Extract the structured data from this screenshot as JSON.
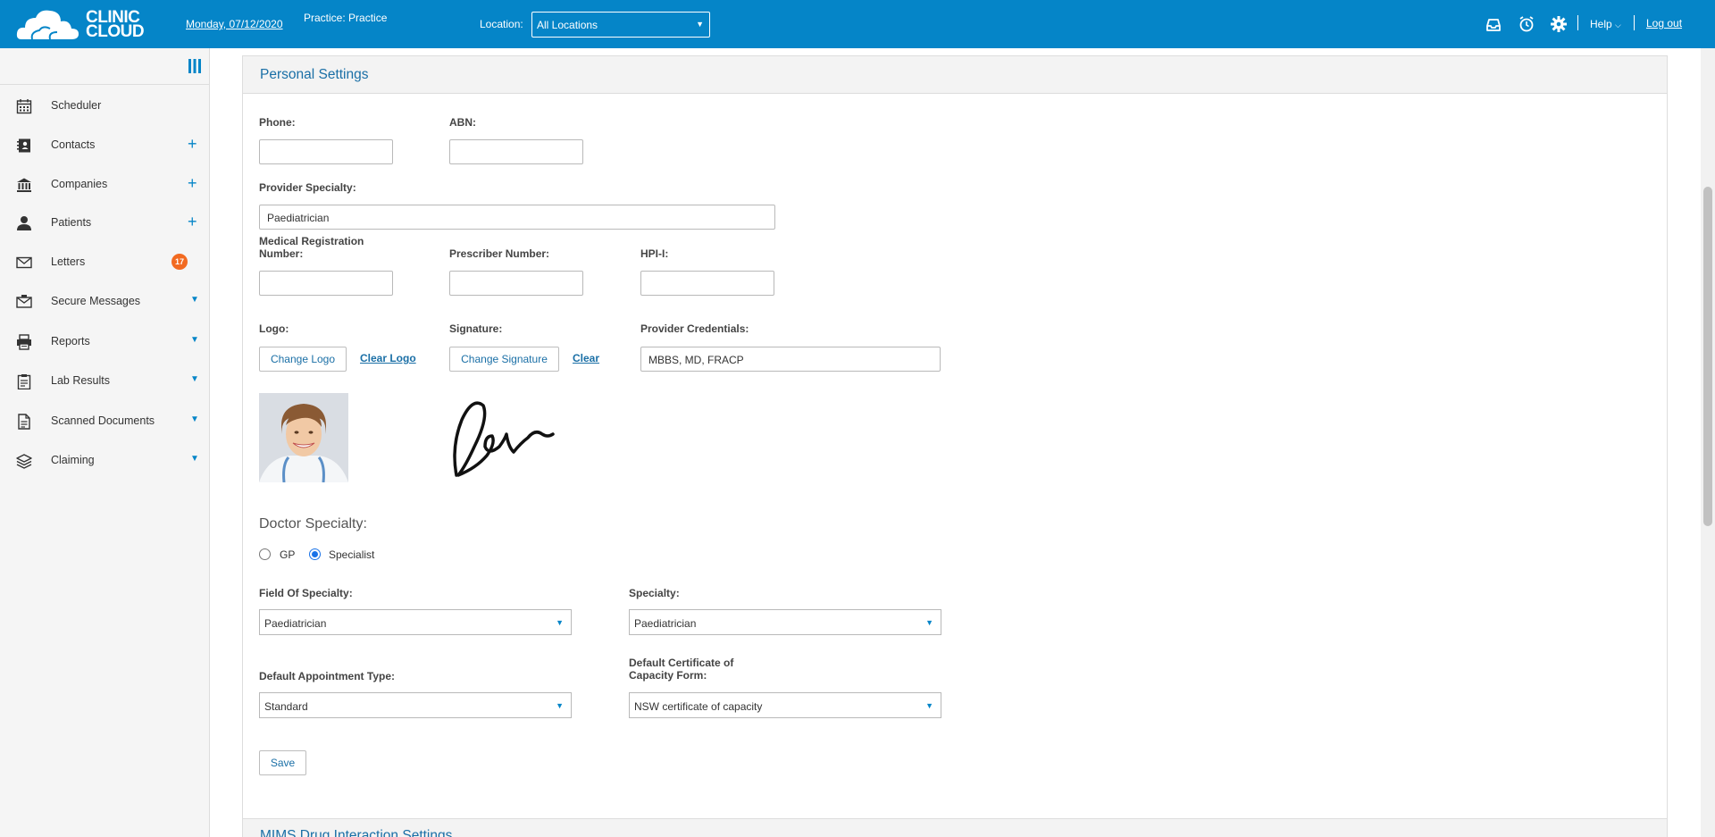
{
  "topbar": {
    "logo_text_line1": "CLINIC",
    "logo_text_line2": "CLOUD",
    "date": "Monday, 07/12/2020",
    "practice": "Practice: Practice",
    "location_label": "Location:",
    "location_value": "All Locations",
    "help": "Help",
    "logout": "Log out",
    "bg_color": "#0585c8"
  },
  "sidebar": {
    "items": [
      {
        "label": "Scheduler",
        "icon": "calendar-icon",
        "action": ""
      },
      {
        "label": "Contacts",
        "icon": "contacts-icon",
        "action": "+"
      },
      {
        "label": "Companies",
        "icon": "bank-icon",
        "action": "+"
      },
      {
        "label": "Patients",
        "icon": "person-icon",
        "action": "+"
      },
      {
        "label": "Letters",
        "icon": "envelope-icon",
        "badge": "17"
      },
      {
        "label": "Secure Messages",
        "icon": "secure-mail-icon",
        "action": "▼"
      },
      {
        "label": "Reports",
        "icon": "printer-icon",
        "action": "▼"
      },
      {
        "label": "Lab Results",
        "icon": "clipboard-icon",
        "action": "▼"
      },
      {
        "label": "Scanned Documents",
        "icon": "document-icon",
        "action": "▼"
      },
      {
        "label": "Claiming",
        "icon": "layers-icon",
        "action": "▼"
      }
    ]
  },
  "panel": {
    "title": "Personal Settings",
    "footer_title": "MIMS Drug Interaction Settings",
    "phone_label": "Phone:",
    "phone_value": "",
    "abn_label": "ABN:",
    "abn_value": "",
    "provider_specialty_label": "Provider Specialty:",
    "provider_specialty_value": "Paediatrician",
    "med_reg_label_1": "Medical Registration",
    "med_reg_label_2": "Number:",
    "med_reg_value": "",
    "prescriber_label": "Prescriber Number:",
    "prescriber_value": "",
    "hpii_label": "HPI-I:",
    "hpii_value": "",
    "logo_label": "Logo:",
    "change_logo": "Change Logo",
    "clear_logo": "Clear Logo",
    "signature_label": "Signature:",
    "change_signature": "Change Signature",
    "clear_signature": "Clear",
    "credentials_label": "Provider Credentials:",
    "credentials_value": "MBBS, MD, FRACP",
    "doctor_specialty_heading": "Doctor Specialty:",
    "radio_gp": "GP",
    "radio_specialist": "Specialist",
    "field_of_specialty_label": "Field Of Specialty:",
    "field_of_specialty_value": "Paediatrician",
    "specialty_label": "Specialty:",
    "specialty_value": "Paediatrician",
    "default_appt_label": "Default Appointment Type:",
    "default_appt_value": "Standard",
    "default_cert_label_1": "Default Certificate of",
    "default_cert_label_2": "Capacity Form:",
    "default_cert_value": "NSW certificate of capacity",
    "save": "Save"
  }
}
